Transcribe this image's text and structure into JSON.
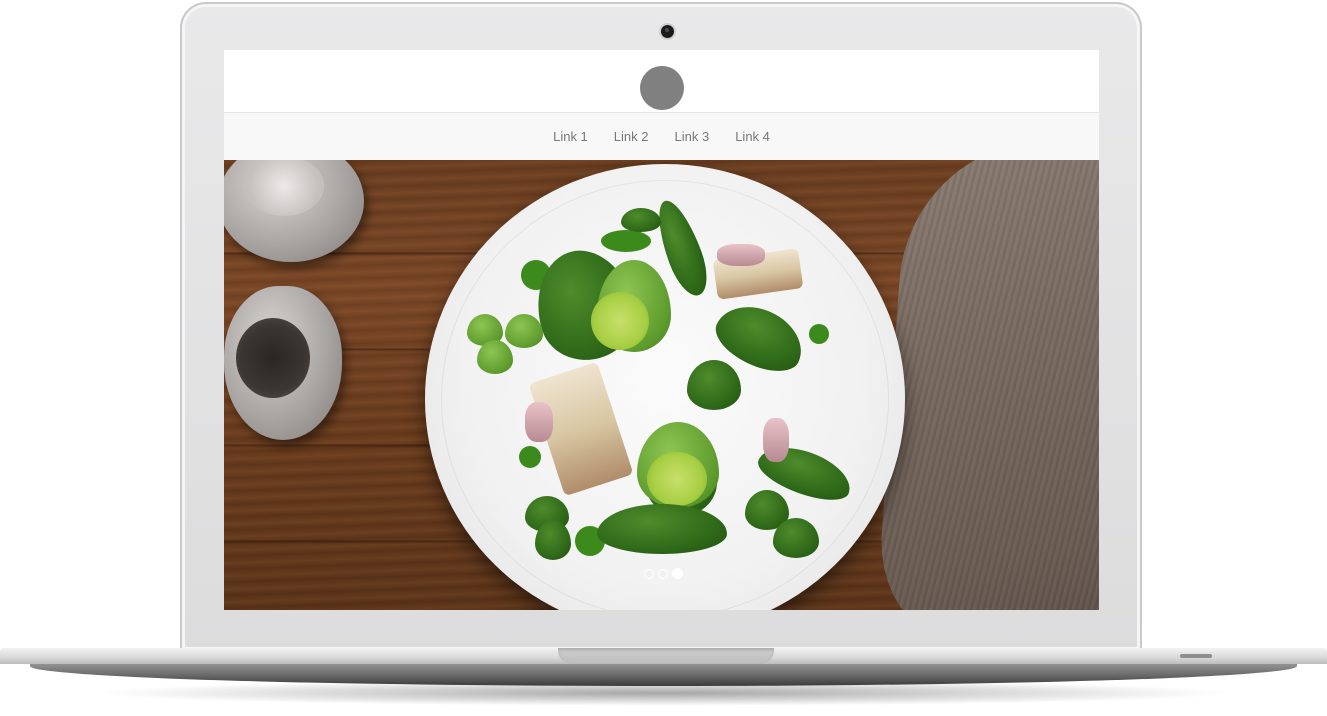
{
  "header": {
    "logo_icon": "circle-logo-icon",
    "logo_color": "#808080"
  },
  "nav": {
    "links": [
      "Link 1",
      "Link 2",
      "Link 3",
      "Link 4"
    ]
  },
  "carousel": {
    "slide_count": 3,
    "active_index": 2
  },
  "colors": {
    "nav_background": "#f8f8f8",
    "nav_text": "#777777",
    "indicator": "#ffffff"
  }
}
